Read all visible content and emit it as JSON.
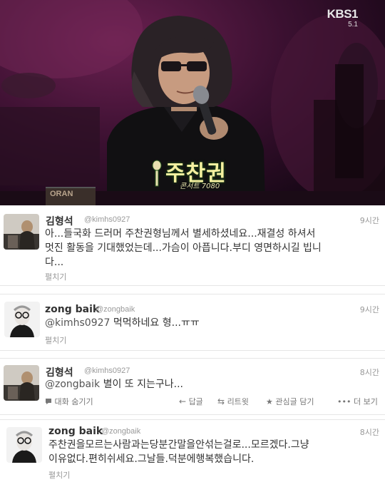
{
  "broadcast": {
    "channel_logo": "KBS1",
    "channel_sub": "5.1",
    "caption_name": "주찬권",
    "caption_sub": "콘서트 7080",
    "amp_label": "ORAN"
  },
  "tweets": [
    {
      "name": "김형석",
      "handle": "@kimhs0927",
      "time": "9시간",
      "text_lines": [
        "아...들국화 드러머 주찬권형님께서 별세하셨네요...재결성 하셔서",
        "멋진 활동을 기대했었는데...가슴이 아픕니다.부디 영면하시길 빕니",
        "다..."
      ],
      "action": "펼치기"
    },
    {
      "name": "zong baik",
      "handle": "@zongbaik",
      "time": "9시간",
      "mention": "@kimhs0927",
      "text": " 먹먹하네요 형...ㅠㅠ",
      "action": "펼치기"
    },
    {
      "name": "김형석",
      "handle": "@kimhs0927",
      "time": "8시간",
      "mention": "@zongbaik",
      "text": " 별이 또 지는구나...",
      "actions": {
        "hide_conversation": "대화 숨기기",
        "reply": "답글",
        "retweet": "리트윗",
        "favorite": "관심글 담기",
        "more": "더 보기"
      }
    },
    {
      "name": "zong baik",
      "handle": "@zongbaik",
      "time": "8시간",
      "text_lines": [
        "주찬권을모르는사람과는당분간말을안섞는걸로...모르겠다.그냥",
        "이유없다.편히쉬세요.그날들.덕분에행복했습니다."
      ],
      "action": "펼치기"
    }
  ]
}
